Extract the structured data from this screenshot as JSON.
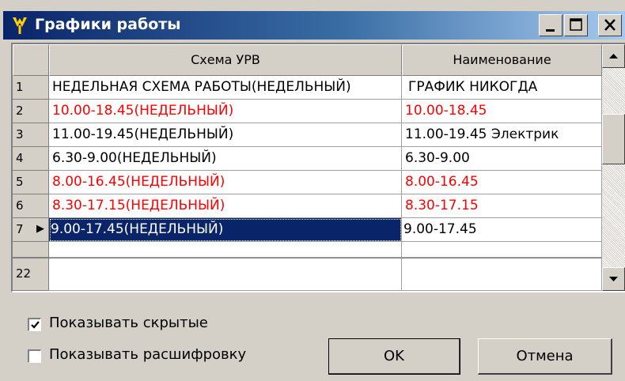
{
  "window": {
    "title": "Графики работы",
    "icon": "app-icon",
    "controls": {
      "minimize": "minimize-icon",
      "maximize": "maximize-icon",
      "close": "close-icon"
    }
  },
  "grid": {
    "columns": [
      "Схема УРВ",
      "Наименование"
    ],
    "rows": [
      {
        "num": "1",
        "scheme": "НЕДЕЛЬНАЯ СХЕМА РАБОТЫ(НЕДЕЛЬНЫЙ)",
        "name": "ГРАФИК НИКОГДА",
        "red": false
      },
      {
        "num": "2",
        "scheme": "10.00-18.45(НЕДЕЛЬНЫЙ)",
        "name": "10.00-18.45",
        "red": true
      },
      {
        "num": "3",
        "scheme": "11.00-19.45(НЕДЕЛЬНЫЙ)",
        "name": "11.00-19.45 Электрик",
        "red": false
      },
      {
        "num": "4",
        "scheme": "6.30-9.00(НЕДЕЛЬНЫЙ)",
        "name": "6.30-9.00",
        "red": false
      },
      {
        "num": "5",
        "scheme": "8.00-16.45(НЕДЕЛЬНЫЙ)",
        "name": "8.00-16.45",
        "red": true
      },
      {
        "num": "6",
        "scheme": "8.30-17.15(НЕДЕЛЬНЫЙ)",
        "name": "8.30-17.15",
        "red": true
      },
      {
        "num": "7",
        "scheme": "9.00-17.45(НЕДЕЛЬНЫЙ)",
        "name": "9.00-17.45",
        "red": false,
        "selected": true
      }
    ],
    "footer_row": {
      "num": "22",
      "scheme": "",
      "name": ""
    },
    "current_row_marker": "▶"
  },
  "options": {
    "show_hidden": {
      "label": "Показывать скрытые",
      "checked": true
    },
    "show_decoding": {
      "label": "Показывать расшифровку",
      "checked": false
    }
  },
  "buttons": {
    "ok": "OK",
    "cancel": "Отмена"
  },
  "colors": {
    "title_start": "#0a246a",
    "title_end": "#a6caf0",
    "highlight_text": "#ff0000",
    "selection": "#0a246a"
  }
}
